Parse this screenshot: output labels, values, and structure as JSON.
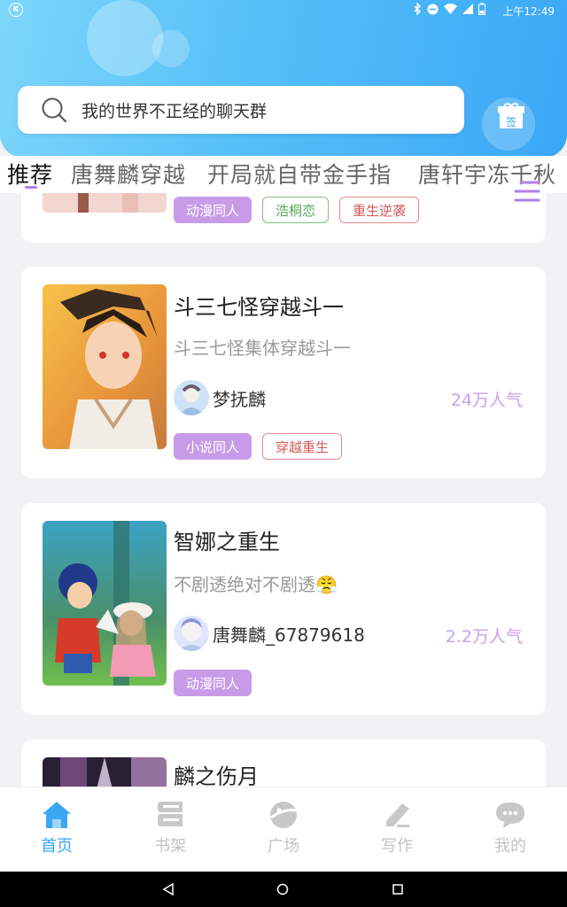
{
  "status_bar": {
    "time": "上午12:49"
  },
  "search": {
    "placeholder_text": "我的世界不正经的聊天群"
  },
  "gift": {
    "label": "签"
  },
  "tabs": [
    {
      "label": "推荐",
      "active": true
    },
    {
      "label": "唐舞麟穿越",
      "active": false
    },
    {
      "label": "开局就自带金手指",
      "active": false
    },
    {
      "label": "唐轩宇冻千秋",
      "active": false
    }
  ],
  "cards": [
    {
      "tags": [
        {
          "label": "动漫同人",
          "style": "purple"
        },
        {
          "label": "浩桐恋",
          "style": "green"
        },
        {
          "label": "重生逆袭",
          "style": "red"
        }
      ]
    },
    {
      "title": "斗三七怪穿越斗一",
      "desc": "斗三七怪集体穿越斗一",
      "author": "梦抚麟",
      "popularity": "24万人气",
      "tags": [
        {
          "label": "小说同人",
          "style": "purple"
        },
        {
          "label": "穿越重生",
          "style": "red"
        }
      ]
    },
    {
      "title": "智娜之重生",
      "desc": "不剧透绝对不剧透😤",
      "author": "唐舞麟_67879618",
      "popularity": "2.2万人气",
      "tags": [
        {
          "label": "动漫同人",
          "style": "purple"
        }
      ]
    },
    {
      "title": "麟之伤月"
    }
  ],
  "nav": [
    {
      "label": "首页",
      "icon": "home-icon",
      "active": true
    },
    {
      "label": "书架",
      "icon": "bookshelf-icon",
      "active": false
    },
    {
      "label": "广场",
      "icon": "square-icon",
      "active": false
    },
    {
      "label": "写作",
      "icon": "write-icon",
      "active": false
    },
    {
      "label": "我的",
      "icon": "profile-icon",
      "active": false
    }
  ],
  "colors": {
    "accent": "#3aa7f6",
    "tag_purple": "#c89be8",
    "popularity": "#c9a1ea"
  }
}
